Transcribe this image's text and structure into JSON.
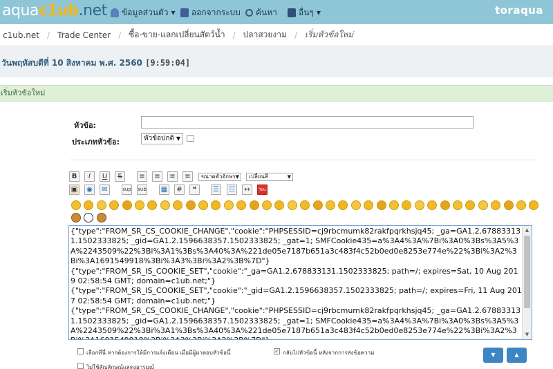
{
  "navbar": {
    "logo": {
      "part1": "aqua",
      "part2": "c1ub",
      "part3": ".net"
    },
    "items": [
      {
        "label": "ข้อมูลส่วนตัว",
        "icon": "user-icon",
        "has_dropdown": true
      },
      {
        "label": "ออกจากระบบ",
        "icon": "logout-icon",
        "has_dropdown": false
      },
      {
        "label": "ค้นหา",
        "icon": "search-icon",
        "has_dropdown": false
      },
      {
        "label": "อื่นๆ",
        "icon": "menu-icon",
        "has_dropdown": true
      }
    ],
    "username": "toraqua"
  },
  "breadcrumb": [
    "c1ub.net",
    "Trade Center",
    "ซื้อ-ขาย-แลกเปลี่ยนสัตว์น้ำ",
    "ปลาสวยงาม",
    "เริ่มหัวข้อใหม่"
  ],
  "date": {
    "text": "วันพฤหัสบดีที่ 10 สิงหาคม พ.ศ. 2560",
    "time": "[9:59:04]"
  },
  "section_title": "เริ่มหัวข้อใหม่",
  "form": {
    "subject_label": "หัวข้อ:",
    "subject_value": "",
    "type_label": "ประเภทหัวข้อ:",
    "type_value": "หัวข้อปกติ"
  },
  "toolbar": {
    "row1": [
      {
        "name": "bold-button",
        "glyph": "B"
      },
      {
        "name": "italic-button",
        "glyph": "I"
      },
      {
        "name": "underline-button",
        "glyph": "U"
      },
      {
        "name": "strike-button",
        "glyph": "S"
      },
      {
        "name": "align-left-button",
        "glyph": "≡"
      },
      {
        "name": "align-center-button",
        "glyph": "≡"
      },
      {
        "name": "align-right-button",
        "glyph": "≡"
      },
      {
        "name": "justify-button",
        "glyph": "≡"
      }
    ],
    "font_size_select": "ขนาดตัวอักษร",
    "font_face_select": "เปลี่ยนสี",
    "row2": [
      {
        "name": "image-button",
        "glyph": "▣"
      },
      {
        "name": "link-button",
        "glyph": "◉"
      },
      {
        "name": "email-button",
        "glyph": "✉"
      },
      {
        "name": "superscript-button",
        "glyph": "sup"
      },
      {
        "name": "subscript-button",
        "glyph": "sub"
      },
      {
        "name": "table-button",
        "glyph": "▦"
      },
      {
        "name": "code-button",
        "glyph": "#"
      },
      {
        "name": "quote-button",
        "glyph": "❝"
      },
      {
        "name": "list-button",
        "glyph": "☰"
      },
      {
        "name": "ordered-list-button",
        "glyph": "☷"
      },
      {
        "name": "hr-button",
        "glyph": "↔"
      },
      {
        "name": "youtube-button",
        "glyph": "You"
      }
    ]
  },
  "smileys": [
    "smile",
    "wink",
    "cheesy",
    "grin",
    "angry",
    "sad",
    "shocked",
    "cool",
    "huh",
    "rolleyes",
    "tongue",
    "embarrassed",
    "lipsrsealed",
    "undecided",
    "kiss",
    "cry",
    "evil",
    "azn",
    "afro",
    "laugh",
    "police",
    "angel",
    "sleepy",
    "think",
    "yawn",
    "dizzy",
    "sick",
    "ninja",
    "devil",
    "confused",
    "scream",
    "love",
    "tired",
    "bored",
    "drool",
    "thumbs",
    "wave",
    "monkey",
    "panda",
    "poop"
  ],
  "editor_text": "{\"type\":\"FROM_SR_CS_COOKIE_CHANGE\",\"cookie\":\"PHPSESSID=cj9rbcmumk82rakfpqrkhsjq45; _ga=GA1.2.678833131.1502333825; _gid=GA1.2.1596638357.1502333825; _gat=1; SMFCookie435=a%3A4%3A%7Bi%3A0%3Bs%3A5%3A%2243509%22%3Bi%3A1%3Bs%3A40%3A%221de05e7187b651a3c483f4c52b0ed0e8253e774e%22%3Bi%3A2%3Bi%3A1691549918%3Bi%3A3%3Bi%3A2%3B%7D\"}\n{\"type\":\"FROM_SR_IS_COOKIE_SET\",\"cookie\":\"_ga=GA1.2.678833131.1502333825; path=/; expires=Sat, 10 Aug 2019 02:58:54 GMT; domain=c1ub.net;\"}\n{\"type\":\"FROM_SR_IS_COOKIE_SET\",\"cookie\":\"_gid=GA1.2.1596638357.1502333825; path=/; expires=Fri, 11 Aug 2017 02:58:54 GMT; domain=c1ub.net;\"}\n{\"type\":\"FROM_SR_CS_COOKIE_CHANGE\",\"cookie\":\"PHPSESSID=cj9rbcmumk82rakfpqrkhsjq45; _ga=GA1.2.678833131.1502333825; _gid=GA1.2.1596638357.1502333825; _gat=1; SMFCookie435=a%3A4%3A%7Bi%3A0%3Bs%3A5%3A%2243509%22%3Bi%3A1%3Bs%3A40%3A%221de05e7187b651a3c483f4c52b0ed0e8253e774e%22%3Bi%3A2%3Bi%3A1691549918%3Bi%3A3%3Bi%3A2%3B%7D\"}",
  "options": {
    "notify_label": "เลือกที่นี่ หากต้องการให้มีการแจ้งเตือน เมื่อมีผู้มาตอบหัวข้อนี้",
    "notify_checked": false,
    "return_label": "กลับไปหัวข้อนี้ หลังจากการส่งข้อความ",
    "return_checked": true,
    "nosmiley_label": "ไม่ใช้สัญลักษณ์แสดงอารมณ์",
    "nosmiley_checked": false
  },
  "buttons": {
    "down_glyph": "▼",
    "up_glyph": "▲"
  },
  "colors": {
    "navbar": "#8ec6d8",
    "section": "#def0d8",
    "button": "#3c86c4",
    "accent": "#f7b51a"
  }
}
